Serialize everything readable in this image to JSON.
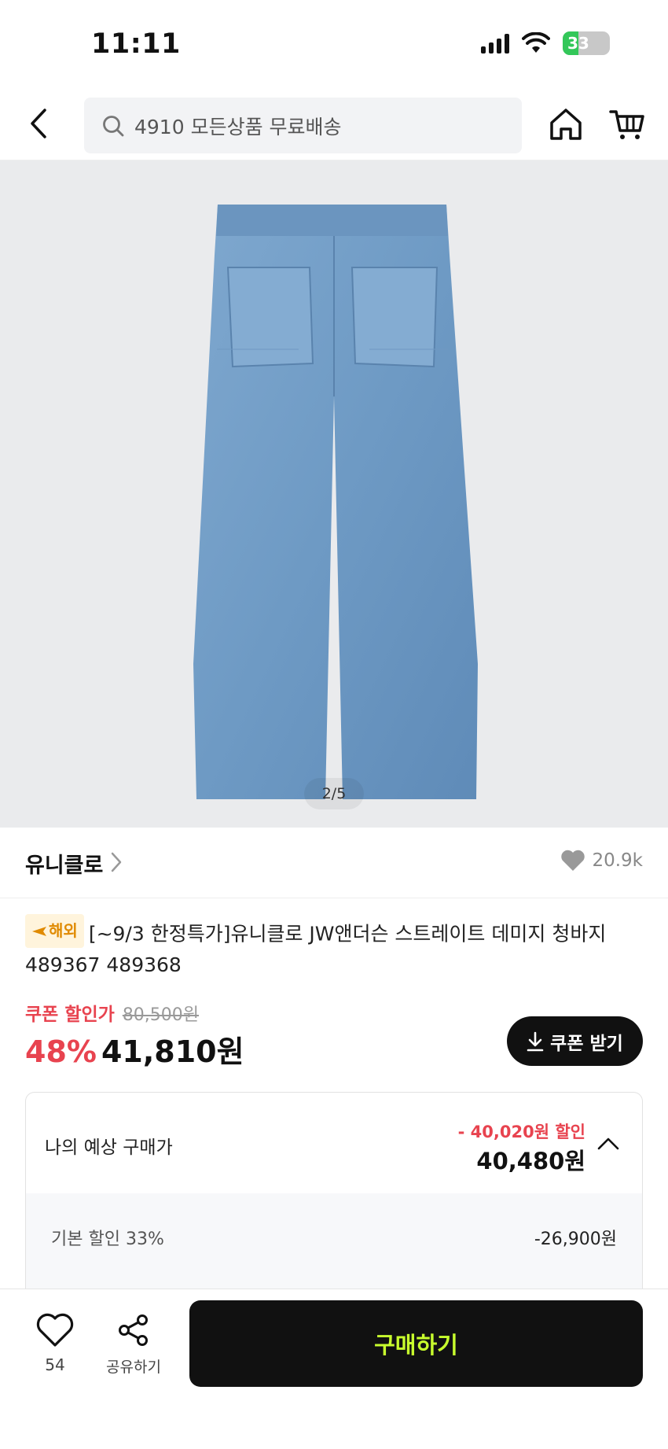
{
  "status_bar": {
    "time": "11:11",
    "battery": "33"
  },
  "search": {
    "placeholder": "4910 모든상품 무료배송"
  },
  "product": {
    "image_counter": "2/5",
    "brand": "유니클로",
    "like_count": "20.9k",
    "badge": "해외",
    "title": "[~9/3 한정특가]유니클로 JW앤더슨 스트레이트 데미지 청바지 489367 489368"
  },
  "price": {
    "coupon_label": "쿠폰 할인가",
    "original": "80,500원",
    "discount_rate": "48%",
    "final": "41,810원",
    "coupon_button": "쿠폰 받기"
  },
  "estimate": {
    "label": "나의 예상 구매가",
    "discount": "- 40,020원 할인",
    "price": "40,480원",
    "rows": [
      {
        "label": "기본 할인 33%",
        "value": "-26,900원"
      }
    ]
  },
  "bottom_bar": {
    "wish_count": "54",
    "share_label": "공유하기",
    "buy_label": "구매하기"
  },
  "colors": {
    "accent_red": "#e8434f",
    "buy_text": "#c8ff2d",
    "dark": "#111111"
  }
}
